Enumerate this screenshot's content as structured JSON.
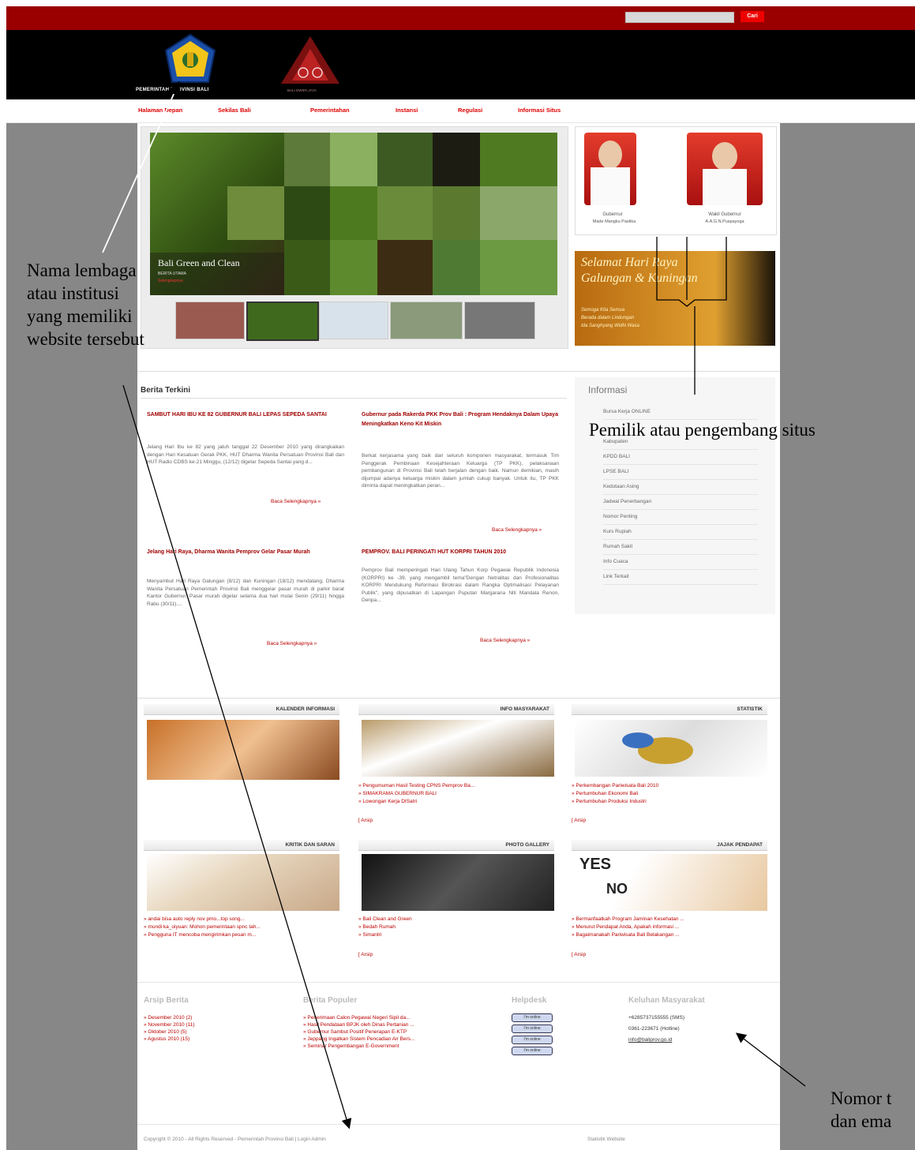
{
  "search": {
    "placeholder": "",
    "button": "Cari"
  },
  "header": {
    "org_name": "PEMERINTAH PROVINSI BALI",
    "motto": "BALI DWIPA JAYA"
  },
  "nav": [
    "Halaman Depan",
    "Sekilas Bali",
    "Pemerintahan",
    "Instansi",
    "Regulasi",
    "Informasi Situs"
  ],
  "slider": {
    "caption": "Bali Green and Clean",
    "sub": "BERITA UTAMA",
    "sub2": "Selengkapnya"
  },
  "officials": [
    {
      "role": "Gubernur",
      "name": "Made Mangku Pastika"
    },
    {
      "role": "Wakil Gubernur",
      "name": "A.A.G.N.Puspayoga"
    }
  ],
  "greeting": {
    "line1": "Selamat Hari Raya",
    "line2": "Galungan & Kuningan",
    "line3": "Semoga Kita Semua",
    "line4": "Berada dalam Lindungan",
    "line5": "Ida Sanghyang Widhi Wasa"
  },
  "news": {
    "heading": "Berita Terkini",
    "items": [
      {
        "title": "SAMBUT HARI IBU KE 82 GUBERNUR BALI LEPAS SEPEDA SANTAI",
        "body": "Jelang Hari Ibu ke 82 yang jatuh tanggal 22 Desember 2010 yang dirangkaikan dengan Hari Kesatuan Gerak PKK, HUT Dharma Wanita Persatuan Provinsi Bali dan HUT Radio CDBS ke-21 Minggu, (12/12) digelar Sepeda Santai yang d...",
        "more": "Baca Selengkapnya »"
      },
      {
        "title": "Gubernur pada Rakerda PKK Prov Bali : Program Hendaknya Dalam Upaya Meningkatkan Keno Kit Miskin",
        "body": "Berkat kerjasama yang baik dari seluruh komponen masyarakat, termasuk Tim Penggerak Pembinaan Kesejahteraan Keluarga (TP PKK), pelaksanaan pembangunan di Provinsi Bali telah berjalan dengan baik. Namun demikian, masih dijumpai adanya keluarga miskin dalam jumlah cukup banyak. Untuk itu, TP PKK diminta dapat meningkatkan peran...",
        "more": "Baca Selengkapnya »"
      },
      {
        "title": "Jelang Hari Raya, Dharma Wanita Pemprov Gelar Pasar Murah",
        "body": "Menyambut Hari Raya Galungan (8/12) dan Kuningan (18/12) mendatang, Dharma Wanita Persatuan Pemerintah Provinsi Bali menggelar pasar murah di parkir barat Kantor Gubernur. Pasar murah digelar selama dua hari mulai Senin (29/11) hingga Rabu (30/11)....",
        "more": "Baca Selengkapnya »"
      },
      {
        "title": "PEMPROV. BALI PERINGATI HUT KORPRI TAHUN 2010",
        "body": "Pemprov Bali memperingati Hari Ulang Tahun Korp Pegawai Republik Indonesia (KORPRI) ke -39, yang mengambil tema\"Dengan Netralitas dan Profesionalitas KORPRI Mendukung Reformasi Birokrasi dalam Rangka Optimalisasi Pelayanan Publik\", yang dipusatkan di Lapangan Puputan Margarana Niti Mandala Renon, Denpa...",
        "more": "Baca Selengkapnya »"
      }
    ]
  },
  "informasi": {
    "heading": "Informasi",
    "items": [
      "Bursa Kerja ONLINE",
      "Kabupaten",
      "KPDD BALI",
      "LPSE BALI",
      "Kedutaan Asing",
      "Jadwal Penerbangan",
      "Nomor Penting",
      "Kurs Rupiah",
      "Rumah Sakit",
      "Info Cuaca",
      "Link Terkait"
    ]
  },
  "sections": [
    {
      "title": "KALENDER INFORMASI",
      "links": [],
      "arsip": ""
    },
    {
      "title": "INFO MASYARAKAT",
      "links": [
        "» Pengumuman Hasil Testing CPNS Pemprov Ba...",
        "» SIMAKRAMA GUBERNUR BALI",
        "» Lowongan Kerja DISatri"
      ],
      "arsip": "[ Arsip"
    },
    {
      "title": "STATISTIK",
      "links": [
        "» Perkembangan Pariwisata Bali 2010",
        "» Pertumbuhan Ekonomi Bali",
        "» Pertumbuhan Produksi Industri"
      ],
      "arsip": "[ Arsip"
    },
    {
      "title": "KRITIK DAN SARAN",
      "links": [
        "» andai bisa auto reply nov pmo...top song...",
        "» mundi ka_oiyuan: Mohon pemerintaan spnc tah...",
        "» Pengguna IT mencoba mengirimkan pesan m..."
      ],
      "arsip": ""
    },
    {
      "title": "PHOTO GALLERY",
      "links": [
        "» Bali Clean and Green",
        "» Bedah Rumah",
        "» Simantri"
      ],
      "arsip": "[ Arsip"
    },
    {
      "title": "JAJAK PENDAPAT",
      "links": [
        "» Bermanfaatkah Program Jaminan Kesehatan ...",
        "» Menurut Pendapat Anda, Apakah informasi ...",
        "» Bagaimanakah Pariwisata Bali Belakangan ..."
      ],
      "arsip": "[ Arsip"
    }
  ],
  "poll_words": {
    "yes": "YES",
    "no": "NO"
  },
  "footer": {
    "arsip": {
      "heading": "Arsip Berita",
      "items": [
        "» Desember 2010 (2)",
        "» November 2010 (11)",
        "» Oktober 2010 (5)",
        "» Agustus 2010 (15)"
      ]
    },
    "populer": {
      "heading": "Berita Populer",
      "items": [
        "» Penerimaan Calon Pegawai Negeri Sipil da...",
        "» Hasil Pendataan BPJK oleh Dinas Pertanian ...",
        "» Gubernur Sambut Positif Penerapan E-KTP",
        "» Jeppang Ingatkan Sistem Pencadian Air Bers...",
        "» Seminar Pengembangan E-Government"
      ]
    },
    "helpdesk": {
      "heading": "Helpdesk",
      "buttons": [
        "I'm online",
        "I'm online",
        "I'm online",
        "I'm online"
      ]
    },
    "keluhan": {
      "heading": "Keluhan Masyarakat",
      "phone1": "+6285737155555 (SMS)",
      "phone2": "0361-223671 (Hotline)",
      "email": "info@baliprov.go.id"
    },
    "copyright": "Copyright © 2010 - All Rights Reserved - Pemerintah Provinsi Bali | Login Admin",
    "stats": "Statistik Website"
  },
  "annotations": {
    "institution": [
      "Nama lembaga",
      "atau institusi",
      "yang memiliki",
      "website tersebut"
    ],
    "owner": "Pemilik atau pengembang situs",
    "contact": [
      "Nomor t",
      "dan ema"
    ]
  },
  "colors": {
    "top_bar": "#9a0000",
    "header": "#000000",
    "accent": "#d00000",
    "sidebar_grey": "#878787"
  }
}
